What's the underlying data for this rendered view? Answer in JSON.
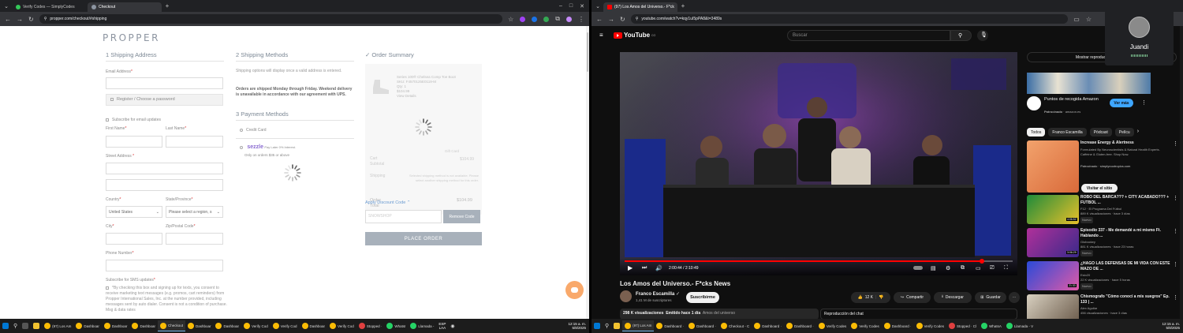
{
  "left_browser": {
    "tabs": [
      {
        "label": "Verify Codes — SimplyCodes",
        "active": false
      },
      {
        "label": "Checkout",
        "active": true
      }
    ],
    "url": "propper.com/checkout/#shipping"
  },
  "checkout": {
    "logo": "PROPPER",
    "shipping_address": {
      "title": "1  Shipping Address",
      "email_label": "Email Address",
      "register_label": "Register / Choose a password",
      "subscribe_email_label": "Subscribe for email updates",
      "first_name_label": "First Name",
      "last_name_label": "Last Name",
      "street_label": "Street Address",
      "country_label": "Country",
      "country_value": "United States",
      "state_label": "State/Province",
      "state_value": "Please select a region, s",
      "city_label": "City",
      "zip_label": "Zip/Postal Code",
      "phone_label": "Phone Number",
      "sms_label": "Subscribe for SMS updates",
      "sms_consent": "*By checking this box and signing up for texts, you consent to receive marketing text messages (e.g. promos, cart reminders) from Propper International Sales, Inc. at the number provided, including messages sent by auto dialer. Consent is not a condition of purchase. Msg & data rates"
    },
    "shipping_methods": {
      "title": "2  Shipping Methods",
      "info": "Shipping options will display once a valid address is entered.",
      "notice": "Orders are shipped Monday through Friday. Weekend delivery is unavailable in accordance with our agreement with UPS."
    },
    "payment_methods": {
      "title": "3  Payment Methods",
      "credit_card": "Credit Card",
      "sezzle": "sezzle",
      "sezzle_info": "Pay Later 0% Interest.",
      "sezzle_note": "Only on orders $35 or above"
    },
    "order_summary": {
      "title": "Order Summary",
      "item_name": "Series 100® Chelsea Comp Toe Boot",
      "item_sku": "SKU: F4570125E0119-M",
      "item_qty": "Qty: 1",
      "item_price": "$104.99",
      "view_details": "View Details",
      "cart_subtotal_label": "Cart Subtotal",
      "cart_subtotal_value": "$104.99",
      "shipping_label": "Shipping",
      "shipping_value": "Selected shipping method is not available. Please select another shipping method for this order.",
      "order_total_label": "Order Total",
      "order_total_value": "$104.99",
      "gift_card_label": "Gift Card",
      "discount_link": "Apply Discount Code",
      "discount_value": "SNOWSHOP",
      "remove_code": "Remove Code",
      "place_order": "PLACE ORDER"
    }
  },
  "right_browser": {
    "tabs": [
      {
        "label": "(97) Los Amos del Universo.- F*ck",
        "active": true
      }
    ],
    "url": "youtube.com/watch?v=kqy1uI5pPA8&t=3489s"
  },
  "youtube": {
    "brand": "YouTube",
    "region": "CO",
    "search_placeholder": "Buscar",
    "video_time": "2:00:44 / 2:10:49",
    "progress_fraction": 0.92,
    "title": "Los Amos del Universo.- F*cks News",
    "channel": "Franco Escamilla",
    "subscribers": "1,41 M de suscriptores",
    "subscribe": "Suscribirme",
    "likes": "12 K",
    "share": "Compartir",
    "download": "Descargar",
    "save": "Guardar",
    "views": "298 K visualizaciones",
    "emitted": "Emitido hace 1 día",
    "hashtag": "Amos del universo",
    "chat_replay": "Reproducción del chat",
    "show_chat": "Mostrar reproducción del chat",
    "ad": {
      "title": "Puntos de recogida Amazon",
      "sponsored": "Patrocinado",
      "domain": "amazon.es",
      "cta": "Ver más"
    },
    "chips": [
      "Todos",
      "Franco Escamilla",
      "Pódcast",
      "Pelícu"
    ],
    "recommendations": [
      {
        "title": "Increase Energy & Alertness",
        "meta": "Formulated By Neuroscientists & Natural Health Experts. Caffeine & Gluten-free. Shop Now.",
        "channel": "Patrocinado · simplynootropics.com",
        "cta": "Visitar el sitio"
      },
      {
        "title": "ROBO DEL BARCA??? + CITY ACABADO??? + FUTBOL ...",
        "channel": "F12 · El Programa Del Fútbol",
        "meta": "889 K visualizaciones · hace 3 días",
        "badge": "Nuevo",
        "duration": "4:06:52"
      },
      {
        "title": "Episodio 337 - Me demandé a mi mismo Ft. Hablando ...",
        "channel": "Globockey",
        "meta": "881 K visualizaciones · hace 23 horas",
        "badge": "Nuevo",
        "duration": "3:06:29"
      },
      {
        "title": "¿HAGO LAS DEFENSAS DE MI VIDA CON ESTE MAZO DE ...",
        "channel": "Eslo20",
        "meta": "22 K visualizaciones · hace 5 horas",
        "badge": "Nuevo",
        "duration": "21:33"
      },
      {
        "title": "Chismografo \"Cómo conocí a mis suegros\" Ep. 133 | ...",
        "channel": "Alex Aguilar",
        "meta": "456 visualizaciones · hace 3 días",
        "badge": "",
        "duration": ""
      }
    ]
  },
  "call": {
    "name": "Juandi"
  },
  "taskbar_left": {
    "items": [
      "(97) Los Am",
      "Dashboar",
      "Dashboar",
      "Dashboar",
      "Checkout",
      "Dashboar",
      "Dashboar",
      "Verify Cod",
      "Verify Cod",
      "Dashboar",
      "Verify Cod",
      "Stopped ·",
      "WhatsI",
      "Llamada -"
    ],
    "lang": "ESP",
    "lang2": "LAA",
    "time": "12:15 a. m.",
    "date": "5/8/2025"
  },
  "taskbar_right": {
    "items": [
      "(97) Los Am",
      "Dashboard ·",
      "Dashboard ·",
      "Checkout - C",
      "Dashboard ·",
      "Dashboard ·",
      "Verify Codes",
      "Verify Codes",
      "Dashboard ·",
      "Verify Codes",
      "Stopped · Cl",
      "WhatsA",
      "Llamada - V"
    ],
    "time": "12:15 a. m.",
    "date": "5/8/2025"
  },
  "colors": {
    "accent": "#a8b1bb",
    "yt_red": "#ff0000",
    "chat_orange": "#f9a96b"
  }
}
